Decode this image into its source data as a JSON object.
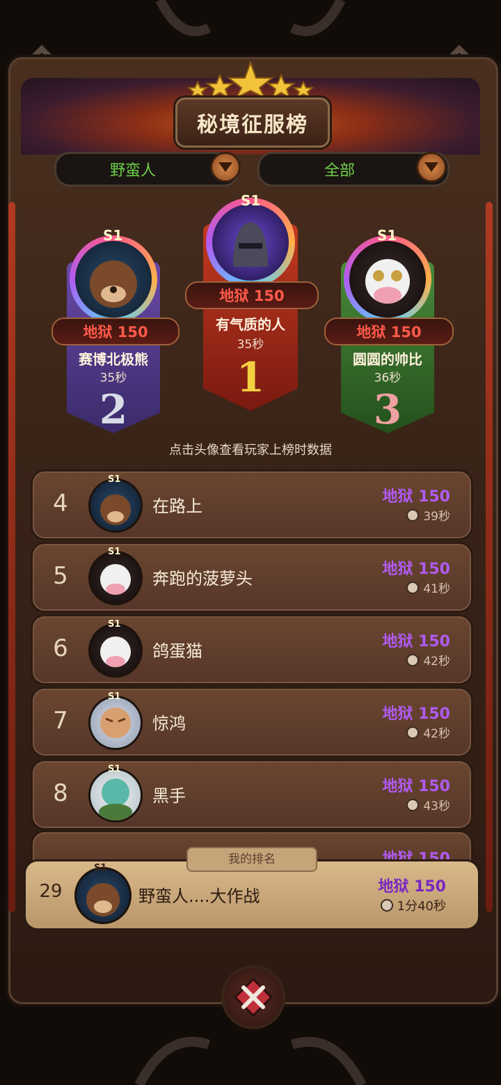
{
  "title": "秘境征服榜",
  "filters": {
    "class": "野蛮人",
    "scope": "全部"
  },
  "podium": [
    {
      "place": "2",
      "season": "S1",
      "level": "地狱 150",
      "name": "赛博北极熊",
      "time": "35秒"
    },
    {
      "place": "1",
      "season": "S1",
      "level": "地狱 150",
      "name": "有气质的人",
      "time": "35秒"
    },
    {
      "place": "3",
      "season": "S1",
      "level": "地狱 150",
      "name": "圆圆的帅比",
      "time": "36秒"
    }
  ],
  "hint": "点击头像查看玩家上榜时数据",
  "list": [
    {
      "rank": "4",
      "season": "S1",
      "name": "在路上",
      "level": "地狱 150",
      "time": "39秒"
    },
    {
      "rank": "5",
      "season": "S1",
      "name": "奔跑的菠萝头",
      "level": "地狱 150",
      "time": "41秒"
    },
    {
      "rank": "6",
      "season": "S1",
      "name": "鸽蛋猫",
      "level": "地狱 150",
      "time": "42秒"
    },
    {
      "rank": "7",
      "season": "S1",
      "name": "惊鸿",
      "level": "地狱 150",
      "time": "42秒"
    },
    {
      "rank": "8",
      "season": "S1",
      "name": "黑手",
      "level": "地狱 150",
      "time": "43秒"
    }
  ],
  "partial_row": {
    "level": "地狱 150"
  },
  "my_rank": {
    "label": "我的排名",
    "rank": "29",
    "season": "S1",
    "name": "野蛮人....大作战",
    "level": "地狱 150",
    "time": "1分40秒"
  },
  "colors": {
    "level_purple": "#b05bf0",
    "level_red": "#ff5a4a",
    "filter_green": "#6fd04a"
  },
  "icons": [
    "star-icon",
    "chevron-down-icon",
    "clock-icon",
    "close-icon"
  ]
}
